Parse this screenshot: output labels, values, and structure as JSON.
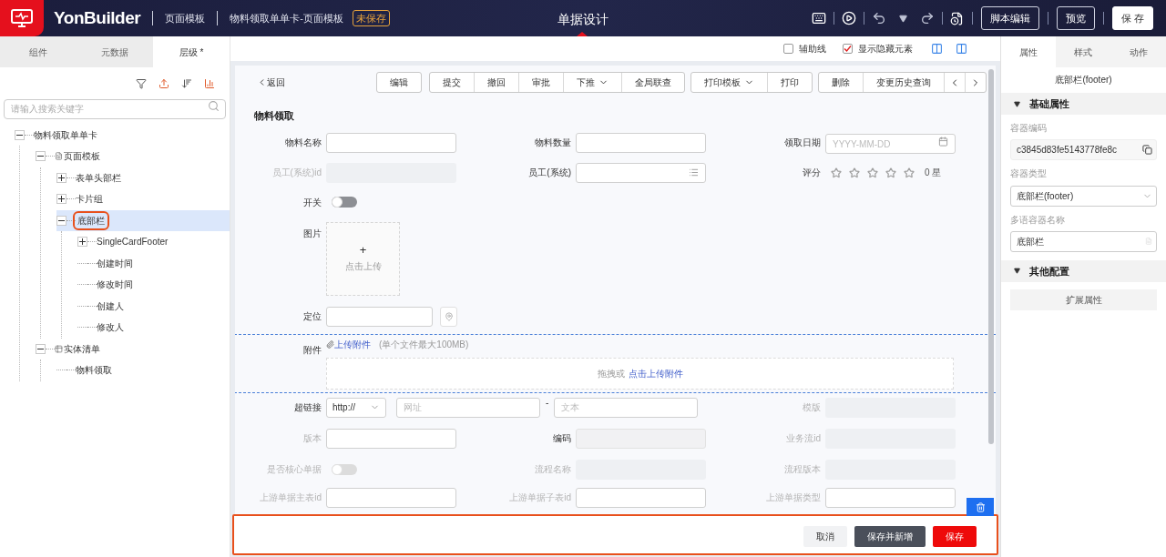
{
  "header": {
    "logo": "YonBuilder",
    "breadcrumbs": [
      "页面模板",
      "物料领取单单卡-页面模板"
    ],
    "badge": "未保存",
    "title": "单据设计",
    "buttons": [
      {
        "label": "脚本编辑",
        "kind": "outline"
      },
      {
        "label": "预览",
        "kind": "outline"
      },
      {
        "label": "保 存",
        "kind": "solid"
      }
    ]
  },
  "left_tabs": [
    {
      "label": "组件",
      "selected": false
    },
    {
      "label": "元数据",
      "selected": false
    },
    {
      "label": "层级 *",
      "selected": true
    }
  ],
  "search": {
    "placeholder": "请输入搜索关键字"
  },
  "tree": [
    {
      "label": "物料领取单单卡",
      "kind": "plain",
      "expanded": true,
      "selected": false,
      "children": [
        {
          "label": "页面模板",
          "kind": "page",
          "expanded": true,
          "selected": false,
          "children": [
            {
              "label": "表单头部栏",
              "kind": "plain",
              "expanded": false,
              "selected": false
            },
            {
              "label": "卡片组",
              "kind": "plain",
              "expanded": false,
              "selected": false
            },
            {
              "label": "底部栏",
              "kind": "plain",
              "expanded": true,
              "selected": true,
              "children": [
                {
                  "label": "SingleCardFooter",
                  "kind": "plain",
                  "expanded": false,
                  "selected": false
                },
                {
                  "label": "创建时间",
                  "kind": "leaf",
                  "selected": false
                },
                {
                  "label": "修改时间",
                  "kind": "leaf",
                  "selected": false
                },
                {
                  "label": "创建人",
                  "kind": "leaf",
                  "selected": false
                },
                {
                  "label": "修改人",
                  "kind": "leaf",
                  "selected": false
                }
              ]
            }
          ]
        },
        {
          "label": "实体清单",
          "kind": "table",
          "expanded": true,
          "selected": false,
          "children": [
            {
              "label": "物料领取",
              "kind": "leaf",
              "selected": false
            }
          ]
        }
      ]
    }
  ],
  "canvas_options": [
    {
      "label": "辅助线",
      "checked": false
    },
    {
      "label": "显示隐藏元素",
      "checked": true
    }
  ],
  "form": {
    "back": "返回",
    "toolbar": [
      [
        {
          "label": "编辑",
          "kind": "text"
        }
      ],
      [
        {
          "label": "提交",
          "kind": "text"
        },
        {
          "label": "撤回",
          "kind": "text"
        },
        {
          "label": "审批",
          "kind": "text"
        },
        {
          "label": "下推",
          "kind": "dropdown"
        },
        {
          "label": "全局联查",
          "kind": "text"
        }
      ],
      [
        {
          "label": "打印模板",
          "kind": "dropdown"
        },
        {
          "label": "打印",
          "kind": "text"
        }
      ],
      [
        {
          "label": "删除",
          "kind": "text"
        },
        {
          "label": "变更历史查询",
          "kind": "text"
        },
        {
          "kind": "prev"
        },
        {
          "kind": "next"
        }
      ]
    ],
    "title": "物料领取",
    "rows": [
      [
        {
          "label": "物料名称",
          "kind": "input",
          "disabled": false
        },
        {
          "label": "物料数量",
          "kind": "input",
          "disabled": false
        },
        {
          "label": "领取日期",
          "kind": "date",
          "placeholder": "YYYY-MM-DD",
          "disabled": false
        }
      ],
      [
        {
          "label": "员工(系统)id",
          "kind": "readonly",
          "disabled": true
        },
        {
          "label": "员工(系统)",
          "kind": "ref",
          "disabled": false
        },
        {
          "label": "评分",
          "kind": "stars",
          "stars": 0,
          "reading": "0 星",
          "disabled": false
        }
      ],
      [
        {
          "label": "开关",
          "kind": "switch",
          "on": false,
          "disabled": false
        }
      ],
      [
        {
          "label": "图片",
          "kind": "image",
          "button": "+",
          "hint": "点击上传",
          "disabled": false
        }
      ],
      [
        {
          "label": "定位",
          "kind": "location",
          "disabled": false
        }
      ],
      [
        {
          "label": "附件",
          "kind": "attachment",
          "link": "上传附件",
          "note": "(单个文件最大100MB)",
          "drop": "拖拽或",
          "drop_link": "点击上传附件",
          "disabled": false
        }
      ],
      [
        {
          "label": "超链接",
          "kind": "url",
          "protocol": "http://",
          "address_placeholder": "网址",
          "separator": "-",
          "text_placeholder": "文本",
          "disabled": false
        },
        "",
        {
          "label": "模版",
          "kind": "readonly",
          "disabled": true
        }
      ],
      [
        {
          "label": "版本",
          "kind": "input",
          "disabled": true
        },
        {
          "label": "编码",
          "kind": "locked",
          "disabled": false
        },
        {
          "label": "业务流id",
          "kind": "readonly",
          "disabled": true
        }
      ],
      [
        {
          "label": "是否核心单据",
          "kind": "switch",
          "on": false,
          "disabled": true
        },
        {
          "label": "流程名称",
          "kind": "readonly",
          "disabled": true
        },
        {
          "label": "流程版本",
          "kind": "readonly",
          "disabled": true
        }
      ],
      [
        {
          "label": "上游单据主表id",
          "kind": "input",
          "disabled": true
        },
        {
          "label": "上游单据子表id",
          "kind": "input",
          "disabled": true
        },
        {
          "label": "上游单据类型",
          "kind": "input",
          "disabled": true
        }
      ]
    ],
    "footer": [
      {
        "label": "取消",
        "kind": "default"
      },
      {
        "label": "保存并新增",
        "kind": "dark"
      },
      {
        "label": "保存",
        "kind": "primary"
      }
    ]
  },
  "right_tabs": [
    {
      "label": "属性",
      "selected": true
    },
    {
      "label": "样式",
      "selected": false
    },
    {
      "label": "动作",
      "selected": false
    }
  ],
  "properties": {
    "title": "底部栏(footer)",
    "sections": [
      {
        "title": "基础属性",
        "expanded": true,
        "fields": [
          {
            "label": "容器编码",
            "value": "c3845d83fe5143778fe8c",
            "kind": "copy"
          },
          {
            "label": "容器类型",
            "value": "底部栏(footer)",
            "kind": "select"
          },
          {
            "label": "多语容器名称",
            "value": "底部栏",
            "kind": "lang"
          }
        ]
      },
      {
        "title": "其他配置",
        "expanded": true,
        "button": "扩展属性"
      }
    ]
  }
}
